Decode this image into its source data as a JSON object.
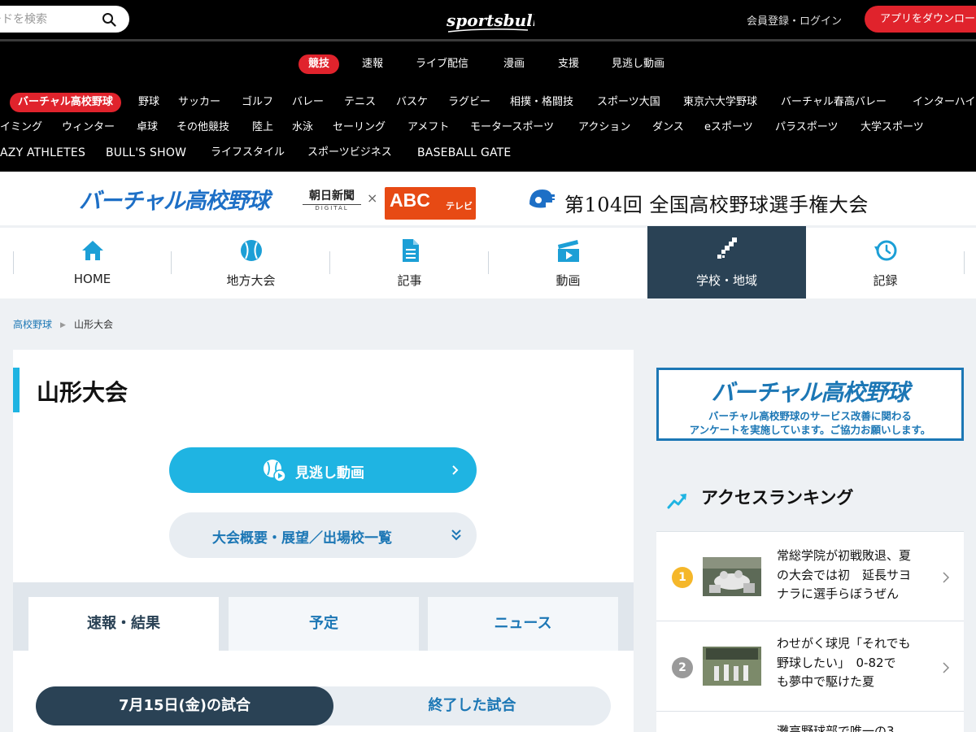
{
  "header": {
    "search_placeholder": "ワードを検索",
    "logo_text": "sportsbull",
    "login_label": "会員登録・ログイン",
    "app_button_label": "アプリをダウンロード"
  },
  "main_nav": [
    {
      "label": "競技",
      "active": true
    },
    {
      "label": "速報",
      "active": false
    },
    {
      "label": "ライブ配信",
      "active": false
    },
    {
      "label": "漫画",
      "active": false
    },
    {
      "label": "支援",
      "active": false
    },
    {
      "label": "見逃し動画",
      "active": false
    }
  ],
  "categories": {
    "row1": [
      "バーチャル高校野球",
      "野球",
      "サッカー",
      "ゴルフ",
      "バレー",
      "テニス",
      "バスケ",
      "ラグビー",
      "相撲・格闘技",
      "スポーツ大国",
      "東京六大学野球",
      "バーチャル春高バレー",
      "インターハイ"
    ],
    "row2": [
      "イミング",
      "ウィンター",
      "卓球",
      "その他競技",
      "陸上",
      "水泳",
      "セーリング",
      "アメフト",
      "モータースポーツ",
      "アクション",
      "ダンス",
      "eスポーツ",
      "パラスポーツ",
      "大学スポーツ"
    ],
    "row3": [
      "AZY ATHLETES",
      "BULL'S SHOW",
      "ライフスタイル",
      "スポーツビジネス",
      "BASEBALL GATE"
    ]
  },
  "banner": {
    "virtual_logo": "バーチャル高校野球",
    "asahi_name": "朝日新聞",
    "asahi_sub": "DIGITAL",
    "times": "×",
    "abc_main": "ABC",
    "abc_tv": "テレビ",
    "tournament": "第104回 全国高校野球選手権大会"
  },
  "sub_nav": [
    {
      "label": "HOME",
      "icon": "home-icon",
      "active": false
    },
    {
      "label": "地方大会",
      "icon": "baseball-icon",
      "active": false
    },
    {
      "label": "記事",
      "icon": "document-icon",
      "active": false
    },
    {
      "label": "動画",
      "icon": "clapperboard-icon",
      "active": false
    },
    {
      "label": "学校・地域",
      "icon": "japan-map-icon",
      "active": true
    },
    {
      "label": "記録",
      "icon": "history-clock-icon",
      "active": false
    }
  ],
  "breadcrumb": {
    "parent": "高校野球",
    "current": "山形大会"
  },
  "page": {
    "title": "山形大会",
    "video_button": "見逃し動画",
    "overview_button": "大会概要・展望／出場校一覧",
    "tabs": [
      {
        "label": "速報・結果",
        "active": true
      },
      {
        "label": "予定",
        "active": false
      },
      {
        "label": "ニュース",
        "active": false
      }
    ],
    "segment": {
      "selected": "7月15日(金)の試合",
      "other": "終了した試合"
    }
  },
  "sidebar": {
    "survey_title": "バーチャル高校野球",
    "survey_line1": "バーチャル高校野球のサービス改善に関わる",
    "survey_line2": "アンケートを実施しています。ご協力お願いします。",
    "ranking_title": "アクセスランキング",
    "ranking": [
      {
        "rank": "1",
        "lines": [
          "常総学院が初戦敗退、夏",
          "の大会では初　延長サヨ",
          "ナラに選手らぼうぜん"
        ],
        "color": "#f5b72a"
      },
      {
        "rank": "2",
        "lines": [
          "わせがく球児「それでも",
          "野球したい」　0-82で",
          "も夢中で駆けた夏"
        ],
        "color": "#9a9a9a"
      }
    ],
    "ranking_partial": "灘高野球部で唯一の3"
  },
  "colors": {
    "accent_red": "#e0232c",
    "accent_blue": "#1fb4e2",
    "link_blue": "#1c77b5",
    "navy": "#2a4255"
  }
}
